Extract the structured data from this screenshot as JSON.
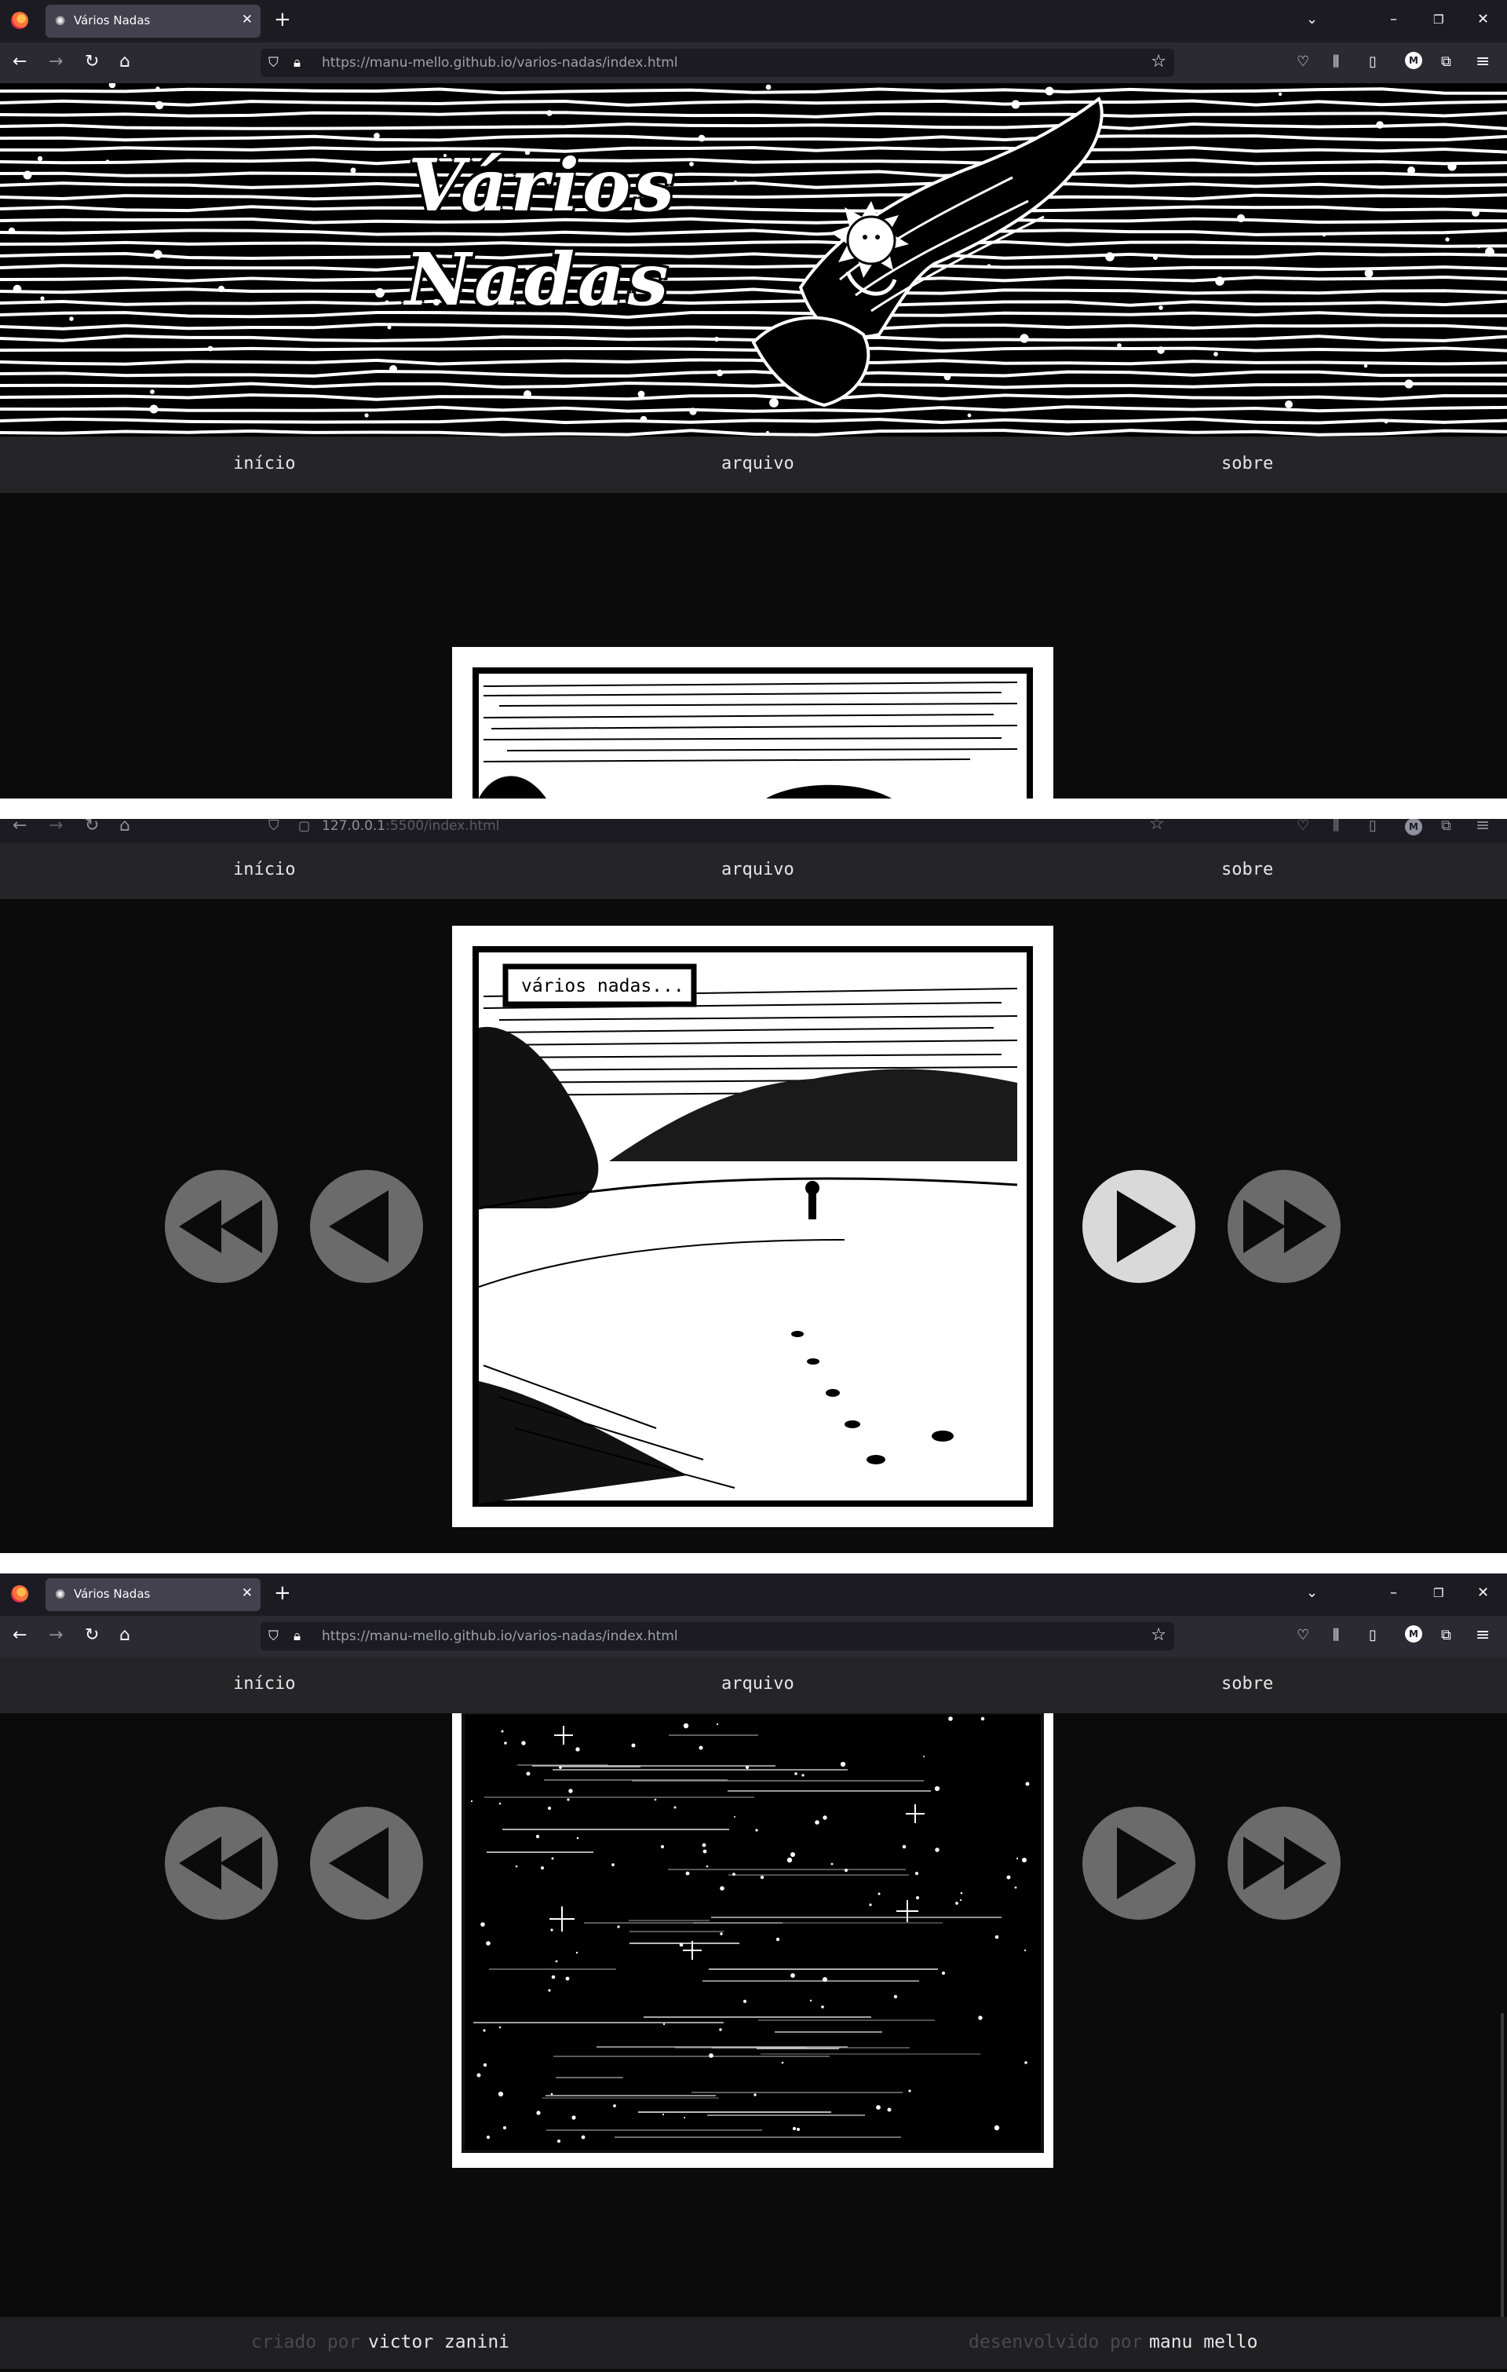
{
  "browser": {
    "tab_title": "Vários Nadas",
    "url_host": "https://manu-mello.github.io",
    "url_path": "/varios-nadas/index.html",
    "local_url_host": "127.0.0.1",
    "local_url_path": ":5500/index.html",
    "avatar_letter": "M"
  },
  "site": {
    "banner_line1": "Vários",
    "banner_line2": "Nadas",
    "nav": {
      "home": "início",
      "archive": "arquivo",
      "about": "sobre"
    },
    "comic_caption": "vários nadas...",
    "footer": {
      "created_label": "criado por",
      "created_name": "victor zanini",
      "dev_label": "desenvolvido por",
      "dev_name": "manu mello"
    }
  },
  "controls": [
    "first-page",
    "previous-page",
    "next-page",
    "last-page"
  ],
  "colors": {
    "background": "#0b0b0c",
    "nav": "#252527",
    "control": "#6b6b6b",
    "control_active": "#d9d9d9"
  }
}
